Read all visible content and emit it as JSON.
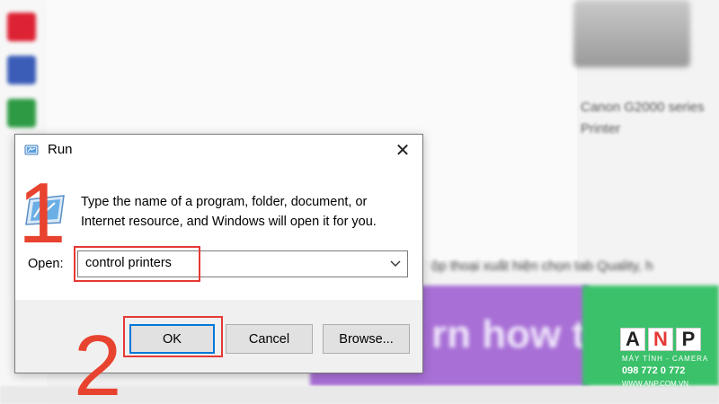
{
  "background": {
    "printer_caption": "Canon G2000 series Printer",
    "article_snippet": "ộp thoại xuất hiện chọn tab Quality, h",
    "banner_text": "rn how to d"
  },
  "dialog": {
    "title": "Run",
    "description": "Type the name of a program, folder, document, or Internet resource, and Windows will open it for you.",
    "open_label": "Open:",
    "open_value": "control printers",
    "buttons": {
      "ok": "OK",
      "cancel": "Cancel",
      "browse": "Browse..."
    },
    "close_symbol": "✕"
  },
  "annotations": {
    "step1": "1",
    "step2": "2",
    "highlight_color": "#e53935"
  },
  "logo": {
    "letters": [
      "A",
      "N",
      "P"
    ],
    "tagline": "MÁY TÍNH - CAMERA",
    "phone": "098 772 0 772",
    "url": "WWW.ANP.COM.VN"
  },
  "icons": {
    "title": "run-icon",
    "big": "run-large-icon",
    "dropdown": "chevron-down-icon",
    "close": "close-icon"
  }
}
